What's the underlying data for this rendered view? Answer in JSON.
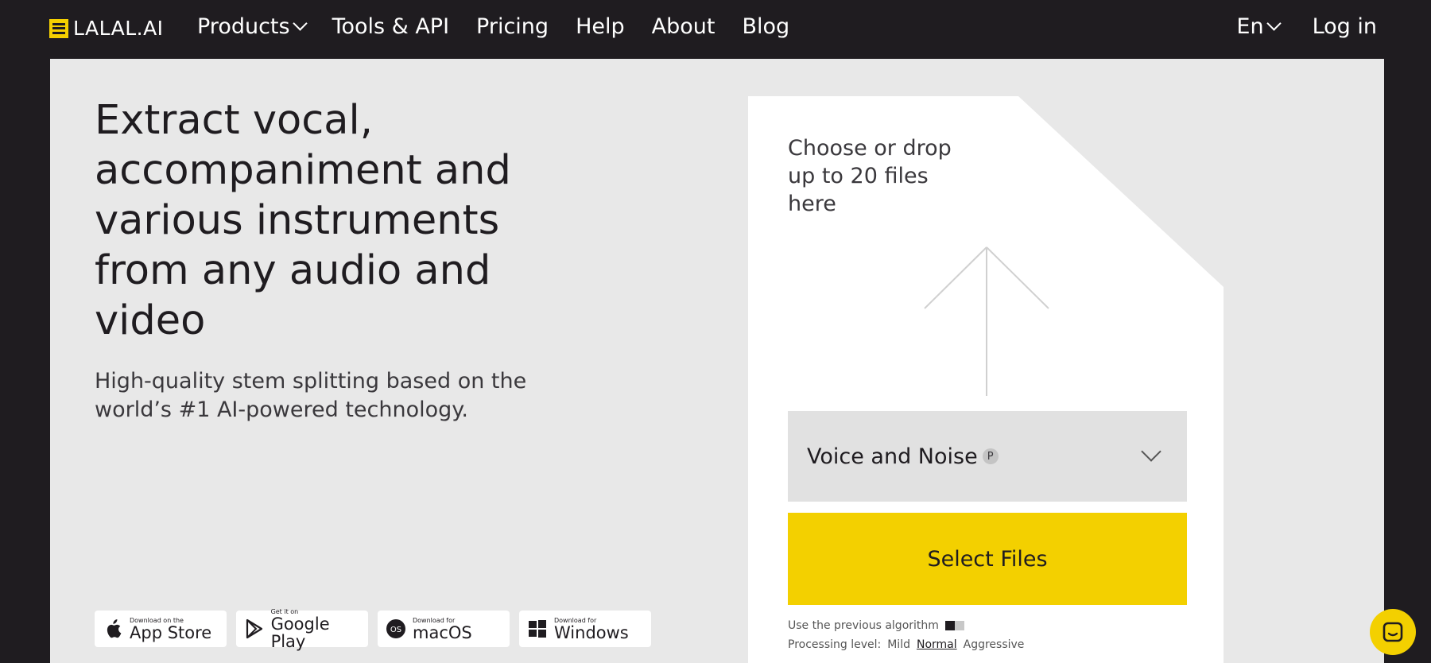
{
  "brand": {
    "name": "LALAL.AI",
    "accent": "#f3d000"
  },
  "nav": {
    "links": [
      {
        "label": "Products",
        "dropdown": true
      },
      {
        "label": "Tools & API"
      },
      {
        "label": "Pricing"
      },
      {
        "label": "Help"
      },
      {
        "label": "About"
      },
      {
        "label": "Blog"
      }
    ],
    "language": "En",
    "login": "Log in"
  },
  "hero": {
    "headline": "Extract vocal, accompaniment and various instruments from any audio and video",
    "subline": "High-quality stem splitting based on the world’s #1 AI-powered technology."
  },
  "stores": [
    {
      "small": "Download on the",
      "big": "App Store",
      "icon": "apple-icon"
    },
    {
      "small": "Get it on",
      "big": "Google Play",
      "icon": "google-play-icon"
    },
    {
      "small": "Download for",
      "big": "macOS",
      "icon": "macos-icon"
    },
    {
      "small": "Download for",
      "big": "Windows",
      "icon": "windows-icon"
    }
  ],
  "uploader": {
    "drop_text": "Choose or drop up to 20 files here",
    "selected_option": "Voice and Noise",
    "badge": "P",
    "select_button": "Select Files",
    "previous_algorithm_label": "Use the previous algorithm",
    "processing_label": "Processing level:",
    "levels": [
      "Mild",
      "Normal",
      "Aggressive"
    ],
    "active_level": "Normal"
  }
}
